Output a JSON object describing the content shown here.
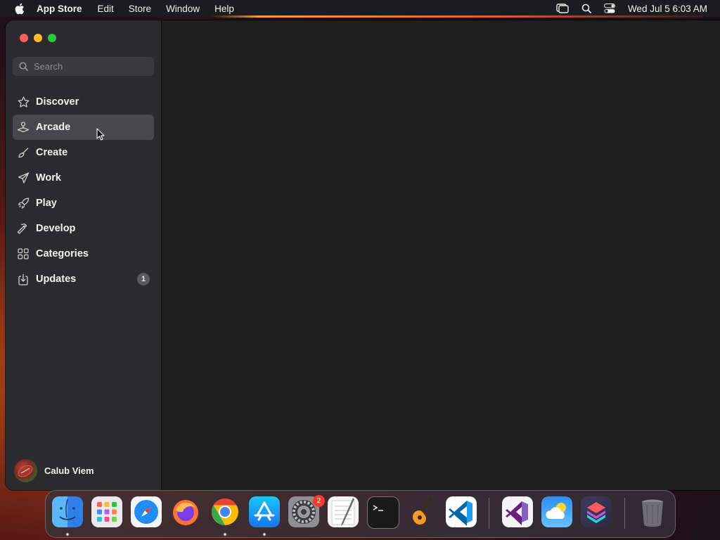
{
  "menubar": {
    "app_name": "App Store",
    "items": [
      "Edit",
      "Store",
      "Window",
      "Help"
    ],
    "clock": "Wed Jul 5  6:03 AM"
  },
  "search": {
    "placeholder": "Search",
    "value": ""
  },
  "sidebar": {
    "items": [
      {
        "label": "Discover",
        "icon": "star-icon"
      },
      {
        "label": "Arcade",
        "icon": "joystick-icon",
        "selected": true
      },
      {
        "label": "Create",
        "icon": "brush-icon"
      },
      {
        "label": "Work",
        "icon": "paper-plane-icon"
      },
      {
        "label": "Play",
        "icon": "rocket-icon"
      },
      {
        "label": "Develop",
        "icon": "hammer-icon"
      },
      {
        "label": "Categories",
        "icon": "grid-icon"
      },
      {
        "label": "Updates",
        "icon": "download-icon",
        "badge": "1"
      }
    ]
  },
  "account": {
    "name": "Calub Viem"
  },
  "dock": {
    "apps": [
      {
        "name": "Finder",
        "running": true
      },
      {
        "name": "Launchpad"
      },
      {
        "name": "Safari"
      },
      {
        "name": "Firefox"
      },
      {
        "name": "Chrome",
        "running": true
      },
      {
        "name": "App Store",
        "running": true
      },
      {
        "name": "System Settings",
        "badge": "2"
      },
      {
        "name": "TextEdit"
      },
      {
        "name": "Terminal"
      },
      {
        "name": "GarageBand"
      },
      {
        "name": "Visual Studio Code"
      },
      {
        "name": "Visual Studio"
      },
      {
        "name": "Weather"
      },
      {
        "name": "Shortcuts"
      },
      {
        "name": "Trash"
      }
    ]
  },
  "colors": {
    "close": "#ff5f57",
    "minimize": "#febc2e",
    "maximize": "#28c840",
    "sidebar_bg": "#2b2b2d",
    "content_bg": "#1e1e1e",
    "selected_bg": "#48484b",
    "badge_red": "#ff3b30"
  }
}
